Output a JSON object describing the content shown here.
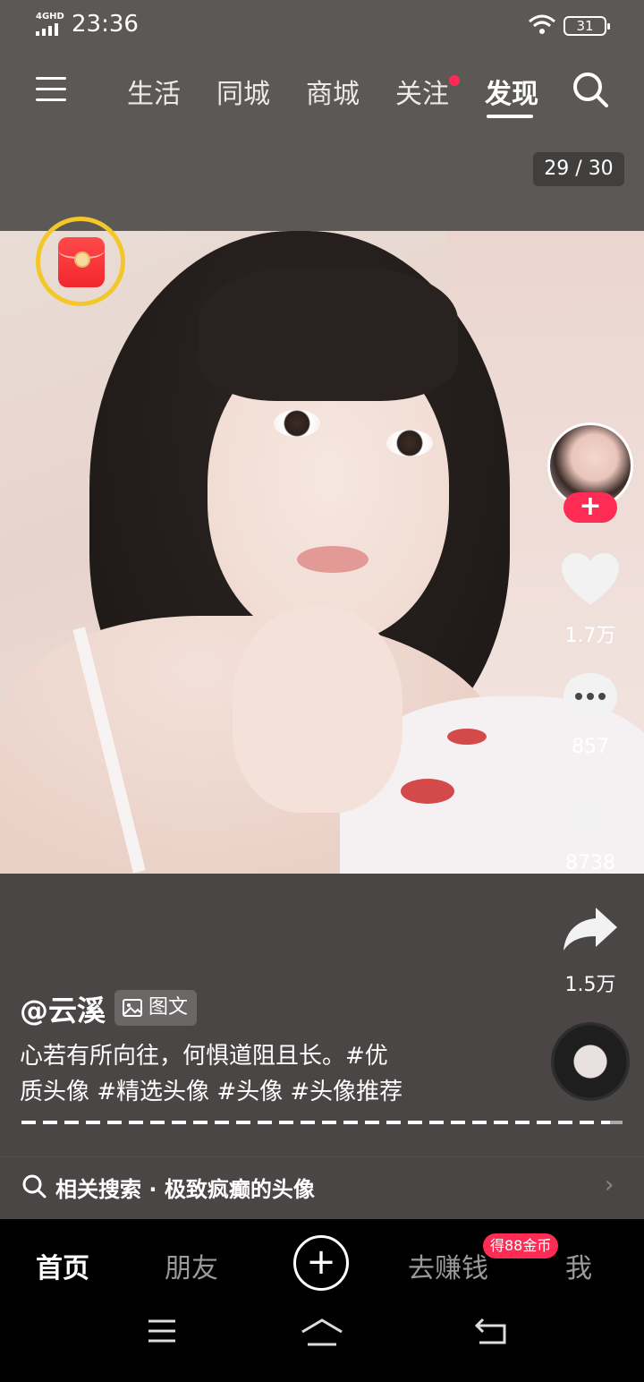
{
  "status_bar": {
    "network": "4GHD",
    "time": "23:36",
    "battery": "31"
  },
  "top_nav": {
    "tabs": [
      "生活",
      "同城",
      "商城",
      "关注",
      "发现"
    ],
    "active_tab": "发现"
  },
  "post": {
    "counter": "29 / 30",
    "author": "@云溪",
    "type_label": "图文",
    "caption_line1": "心若有所向往，何惧道阻且长。#优",
    "caption_line2": "质头像 #精选头像 #头像 #头像推荐",
    "progress": 0.97
  },
  "actions": {
    "likes": "1.7万",
    "comments": "857",
    "favorites": "8738",
    "shares": "1.5万",
    "follow_symbol": "+"
  },
  "related_search": {
    "text": "相关搜索 · 极致疯癫的头像",
    "chevron": "›"
  },
  "bottom_nav": {
    "home": "首页",
    "friends": "朋友",
    "create": "+",
    "earn": "去赚钱",
    "earn_badge": "得88金币",
    "me": "我"
  },
  "colors": {
    "accent": "#fe2c55",
    "ring": "#f3c72a",
    "background": "#4a4644"
  }
}
